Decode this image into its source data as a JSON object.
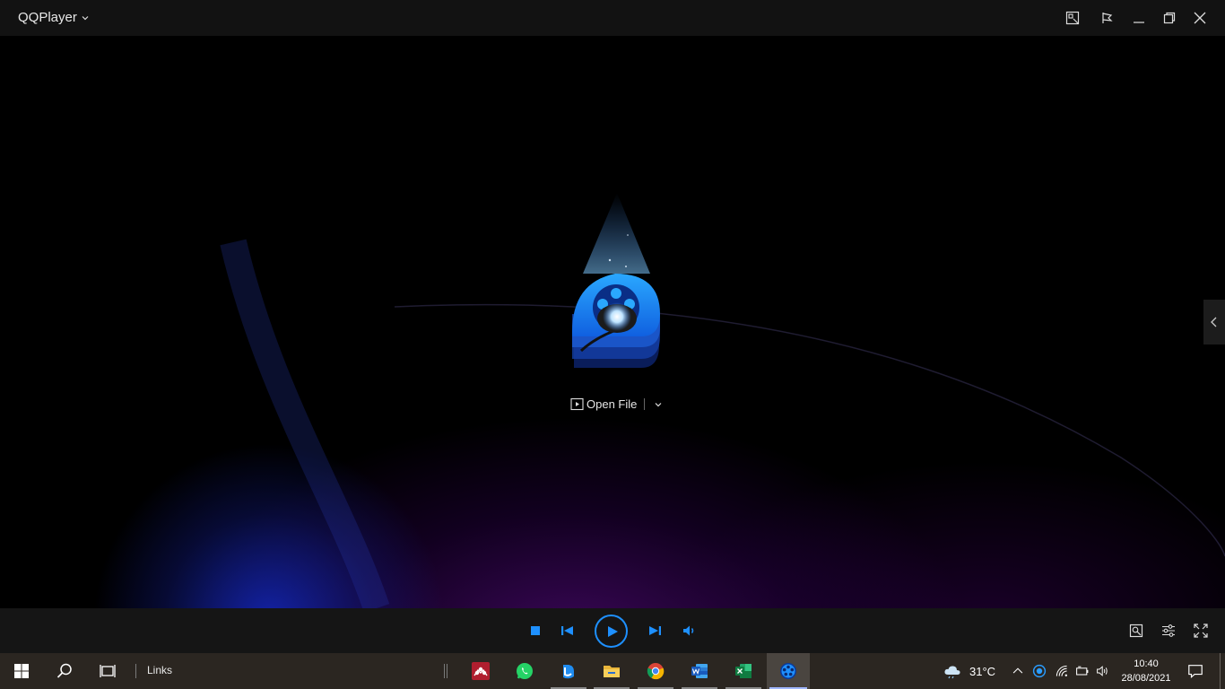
{
  "window": {
    "title": "QQPlayer"
  },
  "stage": {
    "open_file_label": "Open File"
  },
  "colors": {
    "accent": "#1e90ff",
    "titlebar_bg": "#121212",
    "controlbar_bg": "#151515",
    "taskbar_bg": "#2b2621"
  },
  "titlebar_icons": [
    "screenshot-icon",
    "pin-icon",
    "minimize-icon",
    "restore-icon",
    "close-icon"
  ],
  "controls": [
    "stop-icon",
    "previous-icon",
    "play-icon",
    "next-icon",
    "volume-icon",
    "settings-icon",
    "equalizer-icon",
    "fullscreen-icon"
  ],
  "taskbar": {
    "links_label": "Links",
    "apps": [
      "mendeley",
      "whatsapp",
      "edge",
      "file-explorer",
      "chrome",
      "word",
      "excel",
      "qqplayer"
    ],
    "weather_temp": "31°C",
    "time": "10:40",
    "date": "28/08/2021"
  }
}
